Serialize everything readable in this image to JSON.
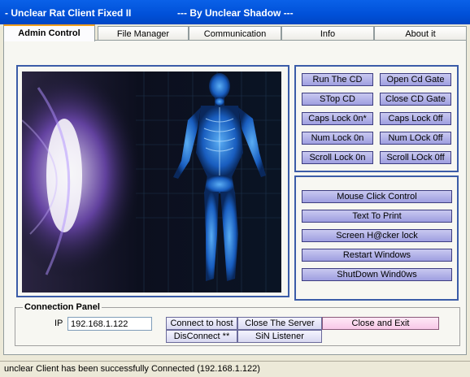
{
  "window": {
    "title_left": "- Unclear Rat Client Fixed II",
    "title_right": "--- By Unclear Shadow ---"
  },
  "tabs": [
    "Admin Control",
    "File Manager",
    "Communication",
    "Info",
    "About it"
  ],
  "active_tab": "Admin Control",
  "cd_buttons": {
    "run_cd": "Run The CD",
    "open_cd_gate": "Open Cd Gate",
    "stop_cd": "STop CD",
    "close_cd_gate": "Close CD Gate",
    "caps_on": "Caps Lock 0n*",
    "caps_off": "Caps Lock 0ff",
    "num_on": "Num Lock 0n",
    "num_off": "Num LOck 0ff",
    "scroll_on": "Scroll Lock 0n",
    "scroll_off": "Scroll LOck 0ff"
  },
  "action_buttons": {
    "mouse_click": "Mouse Click Control",
    "text_print": "Text To Print",
    "screen_lock": "Screen H@cker lock",
    "restart": "Restart Windows",
    "shutdown": "ShutDown Wind0ws"
  },
  "connection": {
    "title": "Connection Panel",
    "ip_label": "IP",
    "ip_value": "192.168.1.122",
    "connect": "Connect to host",
    "close_server": "Close The Server",
    "close_exit": "Close and Exit",
    "disconnect": "DisConnect **",
    "sin_listener": "SiN Listener"
  },
  "status": "unclear Client has been successfully Connected (192.168.1.122)"
}
